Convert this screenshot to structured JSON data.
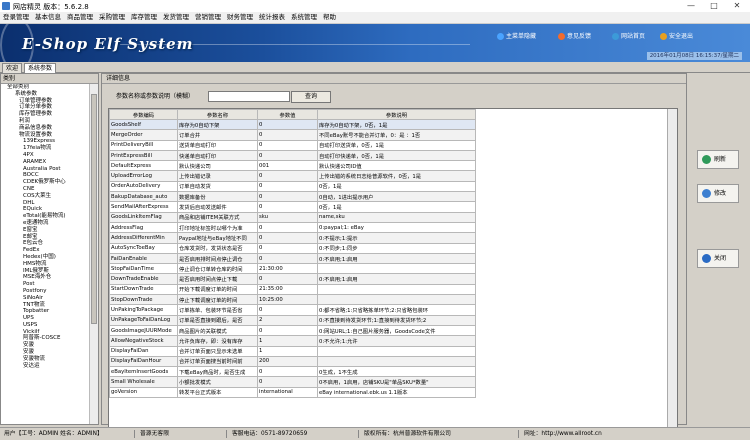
{
  "window": {
    "title": "网店精灵 版本：5.6.2.8",
    "minimize": "—",
    "maximize": "□",
    "close": "✕"
  },
  "menu": [
    "登录管理",
    "基本信息",
    "商品管理",
    "采购管理",
    "库存管理",
    "发货管理",
    "营销管理",
    "财务管理",
    "统计报表",
    "系统管理",
    "帮助"
  ],
  "banner": {
    "logo": "E-Shop Elf System",
    "buttons": [
      {
        "label": "主菜单隐藏",
        "color": "#4aa3ff"
      },
      {
        "label": "意见反馈",
        "color": "#f26b2c"
      },
      {
        "label": "网站首页",
        "color": "#3c9ad8"
      },
      {
        "label": "安全退出",
        "color": "#e8a020"
      }
    ],
    "datetime": "2016年01月08日 16:15:37/星期二"
  },
  "tabs": [
    "欢迎",
    "系统参数"
  ],
  "left_panel": {
    "title": "类别",
    "tree": [
      "全部类别",
      "系统参数",
      "订单管理参数",
      "订单分单参数",
      "库存管理参数",
      "利润",
      "商品信息参数",
      "物流设置参数",
      "139Express",
      "17feia物流",
      "4PX",
      "ARAMEX",
      "Australia Post",
      "BOCC",
      "CDEK俄罗斯中心",
      "CNE",
      "COS大莱生",
      "DHL",
      "EQuick",
      "eTotal(能易物流)",
      "e速通物流",
      "E窗宝",
      "E邮宝",
      "E包云仓",
      "FedEx",
      "Hedex(中国)",
      "HMS物流",
      "IML俄罗斯",
      "MSE海外仓",
      "Post",
      "Postfony",
      "SiNoAir",
      "TNT物流",
      "Topbatter",
      "UPS",
      "USPS",
      "Vickilf",
      "阿普斯-COSCE",
      "安骏",
      "安骏",
      "安骏物流",
      "安达运"
    ]
  },
  "detail": {
    "title": "详细信息",
    "search_label": "参数名称或参数说明（模糊）",
    "search_value": "",
    "search_button": "查询",
    "columns": [
      "参数编码",
      "参数名称",
      "参数值",
      "参数说明"
    ],
    "rows": [
      [
        "GoodsShelf",
        "库存为0自动下架",
        "0",
        "库存为0自动下架，0否，1是"
      ],
      [
        "MergeOrder",
        "订单合并",
        "0",
        "不同eBay账号不能合并订单，0：是 ：1否"
      ],
      [
        "PrintDeliveryBill",
        "送货单自动打印",
        "0",
        "自动打印送货单，0否，1是"
      ],
      [
        "PrintExpressBill",
        "快递单自动打印",
        "0",
        "自动打印快递单，0否，1是"
      ],
      [
        "DefaultExpress",
        "默认快递公司",
        "001",
        "默认快递公司ID值"
      ],
      [
        "UploadErrorLog",
        "上传出错记录",
        "0",
        "上传出错的系统日志给普源软件，0否，1是"
      ],
      [
        "OrderAutoDelivery",
        "订单自动发货",
        "0",
        "0否，1是"
      ],
      [
        "BakupDatabase_auto",
        "数据库备份",
        "0",
        "0自动，1进出提示用户"
      ],
      [
        "SendMailAfterExpress",
        "发货后自动发送邮件",
        "0",
        "0否，1是"
      ],
      [
        "GoodsLinkItemFlag",
        "商品和店铺ITEM关联方式",
        "sku",
        "name,sku"
      ],
      [
        "AddressFlag",
        "打印地址标签时以哪个为准",
        "0",
        "0:paypal;1: eBay"
      ],
      [
        "AddressDifferentMin",
        "Paypal地址与eBay地址不同",
        "0",
        "0:不提示;1:提示"
      ],
      [
        "AutoSyncToeBay",
        "仓库发货时，发货状态是否",
        "0",
        "0:不同步;1:同步"
      ],
      [
        "FaiDanEnable",
        "是否启用排时间点停止调仓",
        "0",
        "0:不启用;1:启用"
      ],
      [
        "StopFaiDanTime",
        "停止调仓订单转仓库的时间",
        "21:30:00",
        ""
      ],
      [
        "DownTradeEnable",
        "是否启用时间点停止下载",
        "0",
        "0:不启用;1:启用"
      ],
      [
        "StartDownTrade",
        "开始下载调度订单的时间",
        "21:35:00",
        ""
      ],
      [
        "StopDownTrade",
        "停止下载调度订单的时间",
        "10:25:00",
        ""
      ],
      [
        "UnPakingToPackage",
        "订单拣单、包装环节是否省",
        "0",
        "0:都不省略;1:只省略拣单环节;2:只省略包装环"
      ],
      [
        "UnPakageToFaiDanLog",
        "订单是否直接到跟后，是否",
        "2",
        "0:不直接到待发货环节;1:直接到待发货环节;2"
      ],
      [
        "GoodsImageJUURMode",
        "商品图片的关联模式",
        "0",
        "0:网站URL;1:自己图片服务器，GoodsCode文件"
      ],
      [
        "AllowNegativeStock",
        "允许负库存，即：没有库存",
        "1",
        "0:不允许;1:允许"
      ],
      [
        "DisplayFaiDan",
        "合并订单页面只显示未选单",
        "1",
        ""
      ],
      [
        "DisplayFaiDanHour",
        "合并订单页面搜当前时间前",
        "200",
        ""
      ],
      [
        "eBayItemInsertGoods",
        "下载eBay商品时，是否生成",
        "0",
        "0生成，1不生成"
      ],
      [
        "Small Wholesale",
        "小额批发模式",
        "0",
        "0不启用，1启用，店铺SKU是\"单品SKU*数量\""
      ],
      [
        "goVersion",
        "转发平台正式版本",
        "international",
        "eBay international.ebk.us 1.1版本"
      ]
    ]
  },
  "side_buttons": [
    {
      "label": "刷新",
      "color": "#2f9a5a"
    },
    {
      "label": "修改",
      "color": "#3d7fd0"
    },
    {
      "label": "关闭",
      "color": "#2a6bc4"
    }
  ],
  "status": {
    "user": "用户【工号：ADMIN 姓名：ADMIN】",
    "release": "普源无客限",
    "phone": "客服电话：0571-89720659",
    "company": "版权所有：杭州普源软件有限公司",
    "website": "网址：http://www.allroot.cn"
  }
}
